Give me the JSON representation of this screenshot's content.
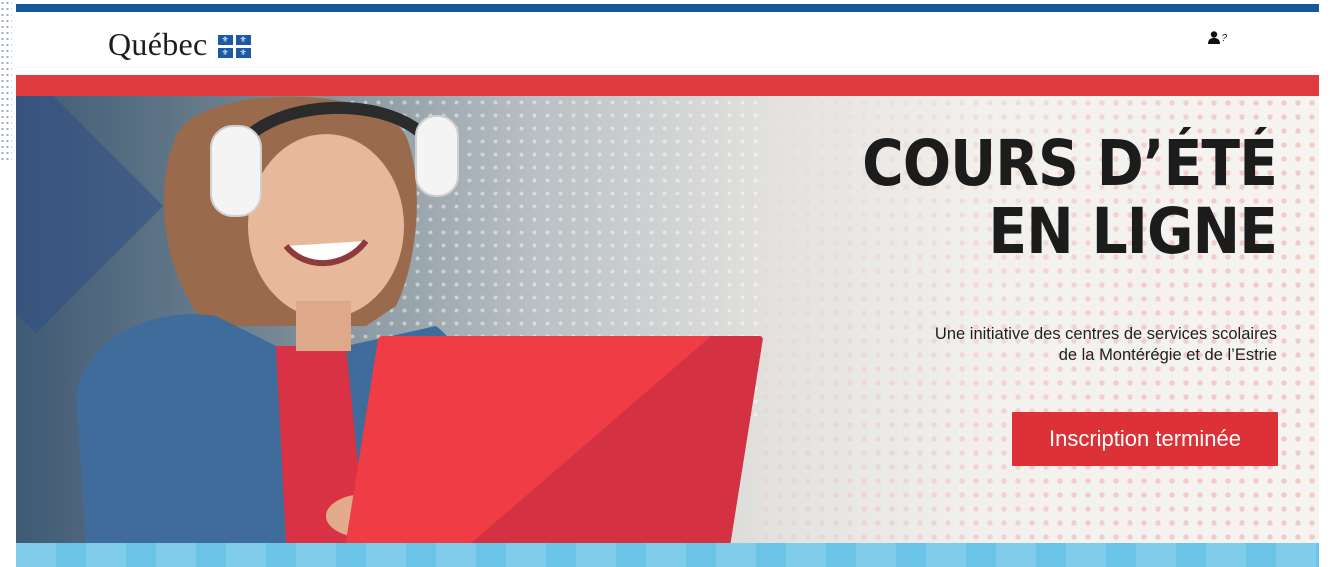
{
  "header": {
    "logo_text": "Québec",
    "flag_glyph": "⚜",
    "user_help_glyph": "?"
  },
  "hero": {
    "title_line1": "COURS D’ÉTÉ",
    "title_line2": "EN LIGNE",
    "subtitle_line1": "Une initiative des centres de services scolaires",
    "subtitle_line2": "de la Montérégie et de l’Estrie",
    "cta_label": "Inscription terminée"
  },
  "colors": {
    "top_bar": "#18599b",
    "red_bar": "#e03a3e",
    "cta": "#dc3137",
    "bottom_bar": "#6ac4e8"
  },
  "icons": {
    "user": "user-help-icon",
    "flag": "quebec-flag-icon"
  }
}
